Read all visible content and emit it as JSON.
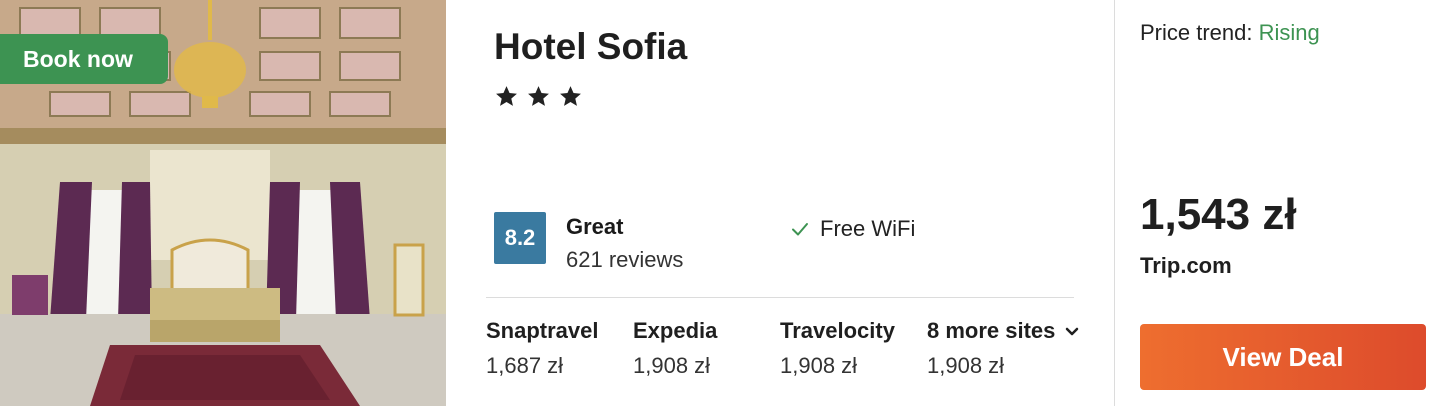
{
  "hotel": {
    "name": "Hotel Sofia",
    "star_rating": 3,
    "book_badge": "Book now",
    "rating": {
      "score": "8.2",
      "label": "Great",
      "reviews": "621 reviews"
    },
    "amenity": "Free WiFi"
  },
  "sites": [
    {
      "name": "Snaptravel",
      "price": "1,687 zł"
    },
    {
      "name": "Expedia",
      "price": "1,908 zł"
    },
    {
      "name": "Travelocity",
      "price": "1,908 zł"
    },
    {
      "name": "8 more sites",
      "price": "1,908 zł"
    }
  ],
  "deal": {
    "trend_label": "Price trend:",
    "trend_value": "Rising",
    "price": "1,543 zł",
    "provider": "Trip.com",
    "button_label": "View Deal"
  },
  "colors": {
    "badge_green": "#3d9352",
    "score_blue": "#3a7aa0",
    "trend_green": "#3d9352",
    "button_orange": "#e85d2e"
  },
  "icons": {
    "star": "star-icon",
    "check": "check-icon",
    "chevron": "chevron-down-icon"
  }
}
